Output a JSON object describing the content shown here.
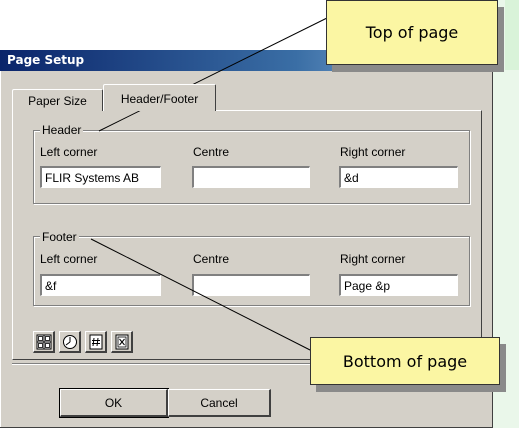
{
  "dialog": {
    "title": "Page Setup",
    "tabs": [
      {
        "label": "Paper Size",
        "selected": false
      },
      {
        "label": "Header/Footer",
        "selected": true
      }
    ],
    "header_group": {
      "label": "Header",
      "left_label": "Left corner",
      "centre_label": "Centre",
      "right_label": "Right corner",
      "left_value": "FLIR Systems AB",
      "centre_value": "",
      "right_value": "&d"
    },
    "footer_group": {
      "label": "Footer",
      "left_label": "Left corner",
      "centre_label": "Centre",
      "right_label": "Right corner",
      "left_value": "&f",
      "centre_value": "",
      "right_value": "Page &p"
    },
    "tool_buttons": [
      "date-icon",
      "clock-icon",
      "page-number-icon",
      "file-name-icon"
    ],
    "ok_label": "OK",
    "cancel_label": "Cancel"
  },
  "callouts": {
    "top": "Top of page",
    "bottom": "Bottom of page"
  },
  "colors": {
    "callout_fill": "#fbf6a3",
    "dialog_face": "#d4d0c8",
    "titlebar": "#0a246a"
  }
}
